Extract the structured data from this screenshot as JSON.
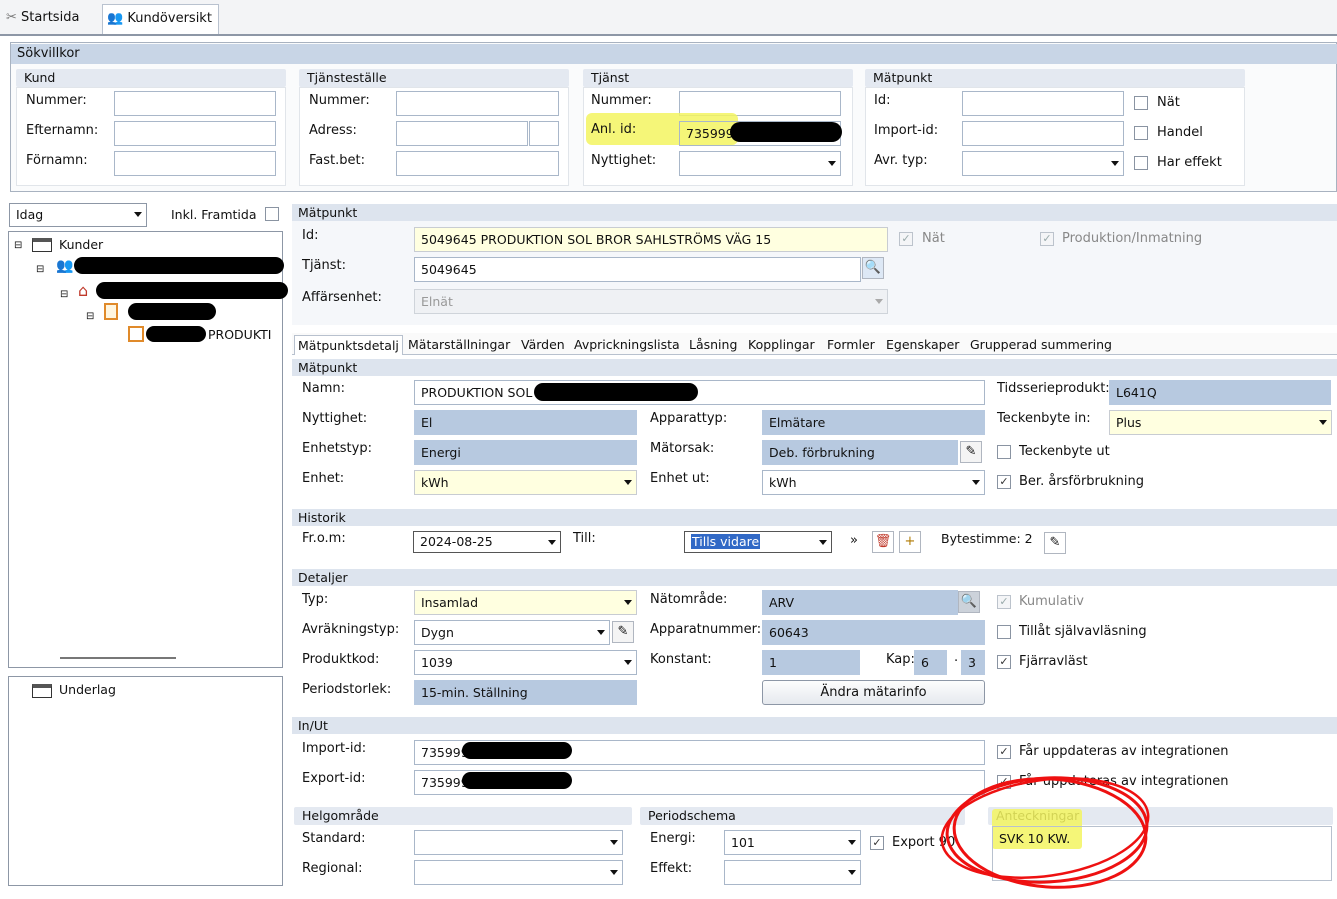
{
  "top_tabs": [
    {
      "label": "Startsida"
    },
    {
      "label": "Kundöversikt"
    }
  ],
  "search": {
    "title": "Sökvillkor",
    "kund": {
      "title": "Kund",
      "nummer": "Nummer:",
      "efternamn": "Efternamn:",
      "fornamn": "Förnamn:"
    },
    "tjanstestalle": {
      "title": "Tjänsteställe",
      "nummer": "Nummer:",
      "adress": "Adress:",
      "fastbet": "Fast.bet:"
    },
    "tjanst": {
      "title": "Tjänst",
      "nummer": "Nummer:",
      "anlid": "Anl. id:",
      "anlid_value": "735999",
      "nyttighet": "Nyttighet:"
    },
    "matpunkt": {
      "title": "Mätpunkt",
      "id": "Id:",
      "importid": "Import-id:",
      "avrtyp": "Avr. typ:",
      "nat": "Nät",
      "handel": "Handel",
      "effekt": "Har effekt"
    }
  },
  "left": {
    "period": "Idag",
    "inkl": "Inkl. Framtida",
    "tree_root": "Kunder",
    "tree_leaf": "PRODUKTI",
    "lower_root": "Underlag"
  },
  "mp": {
    "title": "Mätpunkt",
    "id_label": "Id:",
    "id_value": "5049645 PRODUKTION SOL BROR SAHLSTRÖMS VÄG 15",
    "tjanst_label": "Tjänst:",
    "tjanst_value": "5049645",
    "affars_label": "Affärsenhet:",
    "affars_value": "Elnät",
    "nat": "Nät",
    "produktion": "Produktion/Inmatning"
  },
  "tabs": [
    "Mätpunktsdetalj",
    "Mätarställningar",
    "Värden",
    "Avprickningslista",
    "Låsning",
    "Kopplingar",
    "Formler",
    "Egenskaper",
    "Grupperad summering"
  ],
  "detail": {
    "section": "Mätpunkt",
    "namn_label": "Namn:",
    "namn_value": "PRODUKTION SOL",
    "nyttighet_label": "Nyttighet:",
    "nyttighet_value": "El",
    "apparattyp_label": "Apparattyp:",
    "apparattyp_value": "Elmätare",
    "enhetstyp_label": "Enhetstyp:",
    "enhetstyp_value": "Energi",
    "matorsak_label": "Mätorsak:",
    "matorsak_value": "Deb. förbrukning",
    "enhet_label": "Enhet:",
    "enhet_value": "kWh",
    "enhetut_label": "Enhet ut:",
    "enhetut_value": "kWh",
    "tidsserie_label": "Tidsserieprodukt:",
    "tidsserie_value": "L641Q",
    "teckenin_label": "Teckenbyte in:",
    "teckenin_value": "Plus",
    "teckenut": "Teckenbyte ut",
    "berars": "Ber. årsförbrukning"
  },
  "historik": {
    "section": "Historik",
    "from_label": "Fr.o.m:",
    "from_value": "2024-08-25",
    "till_label": "Till:",
    "till_value": "Tills vidare",
    "bytestimme": "Bytestimme: 2"
  },
  "detaljer": {
    "section": "Detaljer",
    "typ_label": "Typ:",
    "typ_value": "Insamlad",
    "avr_label": "Avräkningstyp:",
    "avr_value": "Dygn",
    "prod_label": "Produktkod:",
    "prod_value": "1039",
    "period_label": "Periodstorlek:",
    "period_value": "15-min. Ställning",
    "natomrade_label": "Nätområde:",
    "natomrade_value": "ARV",
    "appnr_label": "Apparatnummer:",
    "appnr_value": "60643",
    "konstant_label": "Konstant:",
    "konstant_value": "1",
    "kap_label": "Kap:",
    "kap1": "6",
    "kap_sep": "·",
    "kap2": "3",
    "andra": "Ändra mätarinfo",
    "kumulativ": "Kumulativ",
    "tillat": "Tillåt självavläsning",
    "fjarr": "Fjärravläst"
  },
  "inut": {
    "section": "In/Ut",
    "import_label": "Import-id:",
    "import_value": "735999",
    "export_label": "Export-id:",
    "export_value": "735999",
    "far1": "Får uppdateras av integrationen",
    "far2": "Får uppdateras av integrationen"
  },
  "helg": {
    "section": "Helgområde",
    "standard": "Standard:",
    "regional": "Regional:"
  },
  "periodschema": {
    "section": "Periodschema",
    "energi_label": "Energi:",
    "energi_value": "101",
    "effekt_label": "Effekt:",
    "export": "Export 90"
  },
  "anteckningar": {
    "title": "Anteckningar",
    "text": "SVK 10 KW."
  }
}
